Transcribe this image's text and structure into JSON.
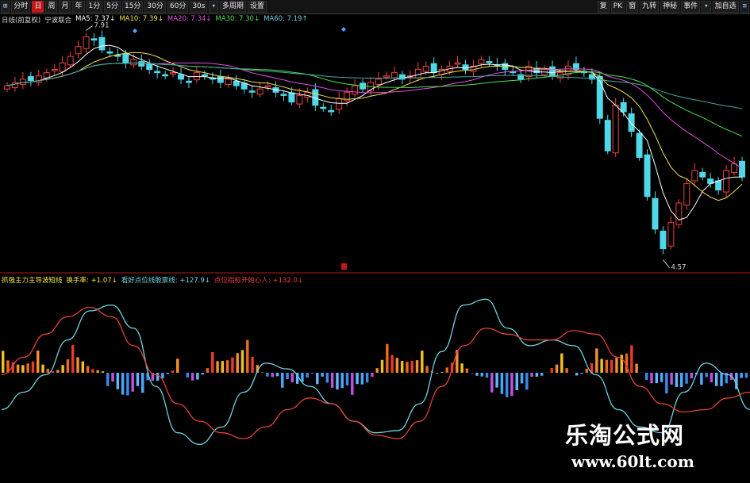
{
  "toolbar": {
    "left": [
      {
        "id": "btn-grid",
        "label": "⊞",
        "icon": "grid-icon",
        "kind": "icon"
      },
      {
        "id": "btn-fenshi",
        "label": "分时",
        "kind": "period"
      },
      {
        "id": "btn-day",
        "label": "日",
        "kind": "period",
        "active": true
      },
      {
        "id": "btn-week",
        "label": "周",
        "kind": "period"
      },
      {
        "id": "btn-month",
        "label": "月",
        "kind": "period"
      },
      {
        "id": "btn-year",
        "label": "年",
        "kind": "period"
      },
      {
        "id": "btn-1m",
        "label": "1分",
        "kind": "period"
      },
      {
        "id": "btn-5m",
        "label": "5分",
        "kind": "period"
      },
      {
        "id": "btn-15m",
        "label": "15分",
        "kind": "period"
      },
      {
        "id": "btn-30m",
        "label": "30分",
        "kind": "period"
      },
      {
        "id": "btn-60m",
        "label": "60分",
        "kind": "period"
      },
      {
        "id": "btn-30s",
        "label": "30s",
        "kind": "period"
      },
      {
        "id": "btn-dropdown",
        "label": "▾",
        "icon": "chevron-down-icon",
        "kind": "icon"
      },
      {
        "id": "btn-multi",
        "label": "多周期",
        "kind": "period"
      },
      {
        "id": "btn-settings",
        "label": "设置",
        "kind": "period"
      }
    ],
    "right": [
      {
        "id": "btn-fu",
        "label": "复",
        "kind": "period"
      },
      {
        "id": "btn-pk",
        "label": "PK",
        "kind": "period"
      },
      {
        "id": "btn-lock",
        "label": "窗",
        "kind": "period"
      },
      {
        "id": "btn-nine",
        "label": "九转",
        "kind": "period"
      },
      {
        "id": "btn-shenbo",
        "label": "神秘",
        "kind": "period"
      },
      {
        "id": "btn-event",
        "label": "事件",
        "kind": "period"
      },
      {
        "id": "btn-event-dd",
        "label": "▾",
        "icon": "chevron-down-icon",
        "kind": "icon"
      },
      {
        "id": "btn-zixuan",
        "label": "加自选",
        "kind": "period"
      },
      {
        "id": "btn-more",
        "label": "≡",
        "icon": "menu-icon",
        "kind": "icon"
      }
    ]
  },
  "main_legend": [
    {
      "text": "日线(前复权)",
      "color": "#d8d8d8"
    },
    {
      "text": "宁波联合",
      "color": "#d8d8d8"
    },
    {
      "text": "MA5: 7.37↓",
      "color": "#ffffff"
    },
    {
      "text": "MA10: 7.39↓",
      "color": "#f0e24a"
    },
    {
      "text": "MA20: 7.34↓",
      "color": "#e64fe6"
    },
    {
      "text": "MA30: 7.30↓",
      "color": "#4fe04f"
    },
    {
      "text": "MA60: 7.19↑",
      "color": "#6fd3e0"
    }
  ],
  "indicator_legend": [
    {
      "text": "抓强主力主导波短线",
      "color": "#f0e24a"
    },
    {
      "text": "换手率: +1.07↓",
      "color": "#f0e24a"
    },
    {
      "text": "看好点位线股票线: +127.9↓",
      "color": "#6fd3e0"
    },
    {
      "text": "点位指标开始心人: +132.0↓",
      "color": "#e8403a"
    }
  ],
  "price_annotations": {
    "high": "7.91",
    "low": "4.57"
  },
  "watermark": {
    "line1": "乐淘公式网",
    "line2": "www.60lt.com"
  },
  "colors": {
    "up": "#f04040",
    "down": "#4fd8e8",
    "ma5": "#ffffff",
    "ma10": "#f0e24a",
    "ma20": "#e64fe6",
    "ma30": "#4fe04f",
    "ma60": "#4aa8a0",
    "grid": "#b01818"
  },
  "chart_data": [
    {
      "type": "candlestick",
      "title": "宁波联合 日线(前复权)",
      "series": [
        {
          "name": "close",
          "values": [
            7.1,
            7.15,
            7.2,
            7.18,
            7.25,
            7.3,
            7.35,
            7.45,
            7.55,
            7.7,
            7.85,
            7.8,
            7.65,
            7.6,
            7.55,
            7.45,
            7.5,
            7.4,
            7.35,
            7.3,
            7.25,
            7.3,
            7.2,
            7.15,
            7.3,
            7.25,
            7.2,
            7.15,
            7.2,
            7.1,
            7.05,
            7.0,
            7.05,
            7.1,
            7.0,
            6.95,
            6.85,
            6.95,
            7.0,
            6.8,
            6.75,
            6.7,
            6.9,
            7.0,
            7.1,
            7.05,
            7.15,
            7.2,
            7.25,
            7.3,
            7.2,
            7.25,
            7.35,
            7.4,
            7.3,
            7.35,
            7.4,
            7.45,
            7.35,
            7.4,
            7.5,
            7.45,
            7.4,
            7.35,
            7.3,
            7.2,
            7.4,
            7.3,
            7.35,
            7.25,
            7.3,
            7.4,
            7.35,
            7.3,
            7.2,
            6.6,
            6.1,
            6.8,
            6.7,
            6.4,
            6.0,
            5.4,
            4.9,
            4.6,
            5.0,
            5.3,
            5.6,
            5.8,
            5.7,
            5.6,
            5.5,
            5.8,
            5.9,
            5.7
          ]
        }
      ],
      "ma": {
        "MA5": 7.37,
        "MA10": 7.39,
        "MA20": 7.34,
        "MA30": 7.3,
        "MA60": 7.19
      },
      "annotations": [
        {
          "label": "7.91"
        },
        {
          "label": "4.57"
        }
      ]
    },
    {
      "type": "line",
      "title": "抓强主力主导波短线",
      "series": [
        {
          "name": "看好点位线股票线",
          "values": [
            40,
            55,
            70,
            100,
            125,
            130,
            110,
            60,
            20,
            10,
            25,
            55,
            80,
            75,
            60,
            45,
            30,
            20,
            22,
            45,
            90,
            130,
            135,
            110,
            95,
            100,
            95,
            70,
            40,
            25,
            20,
            55,
            80,
            70,
            40
          ]
        },
        {
          "name": "点位指标开始心人",
          "values": [
            70,
            85,
            105,
            120,
            128,
            120,
            95,
            70,
            45,
            30,
            20,
            15,
            25,
            40,
            50,
            45,
            30,
            18,
            15,
            30,
            60,
            95,
            110,
            105,
            100,
            100,
            108,
            105,
            85,
            60,
            45,
            38,
            40,
            50,
            55
          ]
        }
      ],
      "values_label": {
        "换手率": 1.07,
        "看好点位线股票线": 127.9,
        "点位指标开始心人": 132.0
      }
    }
  ]
}
